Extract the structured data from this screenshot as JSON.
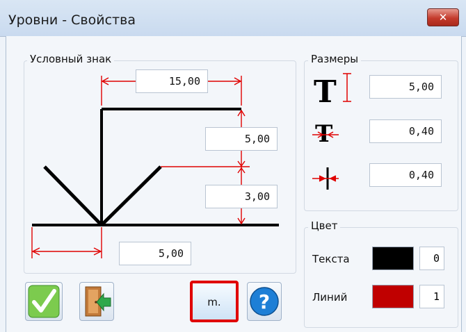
{
  "window": {
    "title": "Уровни - Свойства",
    "close_glyph": "✕"
  },
  "symbol_group": {
    "legend": "Условный знак",
    "fields": {
      "width_top": "15,00",
      "height_upper": "5,00",
      "height_lower": "3,00",
      "offset_bottom": "5,00"
    }
  },
  "sizes_group": {
    "legend": "Размеры",
    "fields": {
      "text_height": "5,00",
      "text_width": "0,40",
      "line_width": "0,40"
    }
  },
  "color_group": {
    "legend": "Цвет",
    "text_label": "Текста",
    "text_color": "#000000",
    "text_index": "0",
    "line_label": "Линий",
    "line_color": "#c00000",
    "line_index": "1"
  },
  "buttons": {
    "units_label": "m.",
    "help_glyph": "?"
  },
  "icons": {
    "ok": "checkmark-icon",
    "exit": "door-exit-icon",
    "help": "help-icon",
    "text_height": "text-height-icon",
    "text_width": "text-width-icon",
    "line_width": "line-width-icon"
  }
}
